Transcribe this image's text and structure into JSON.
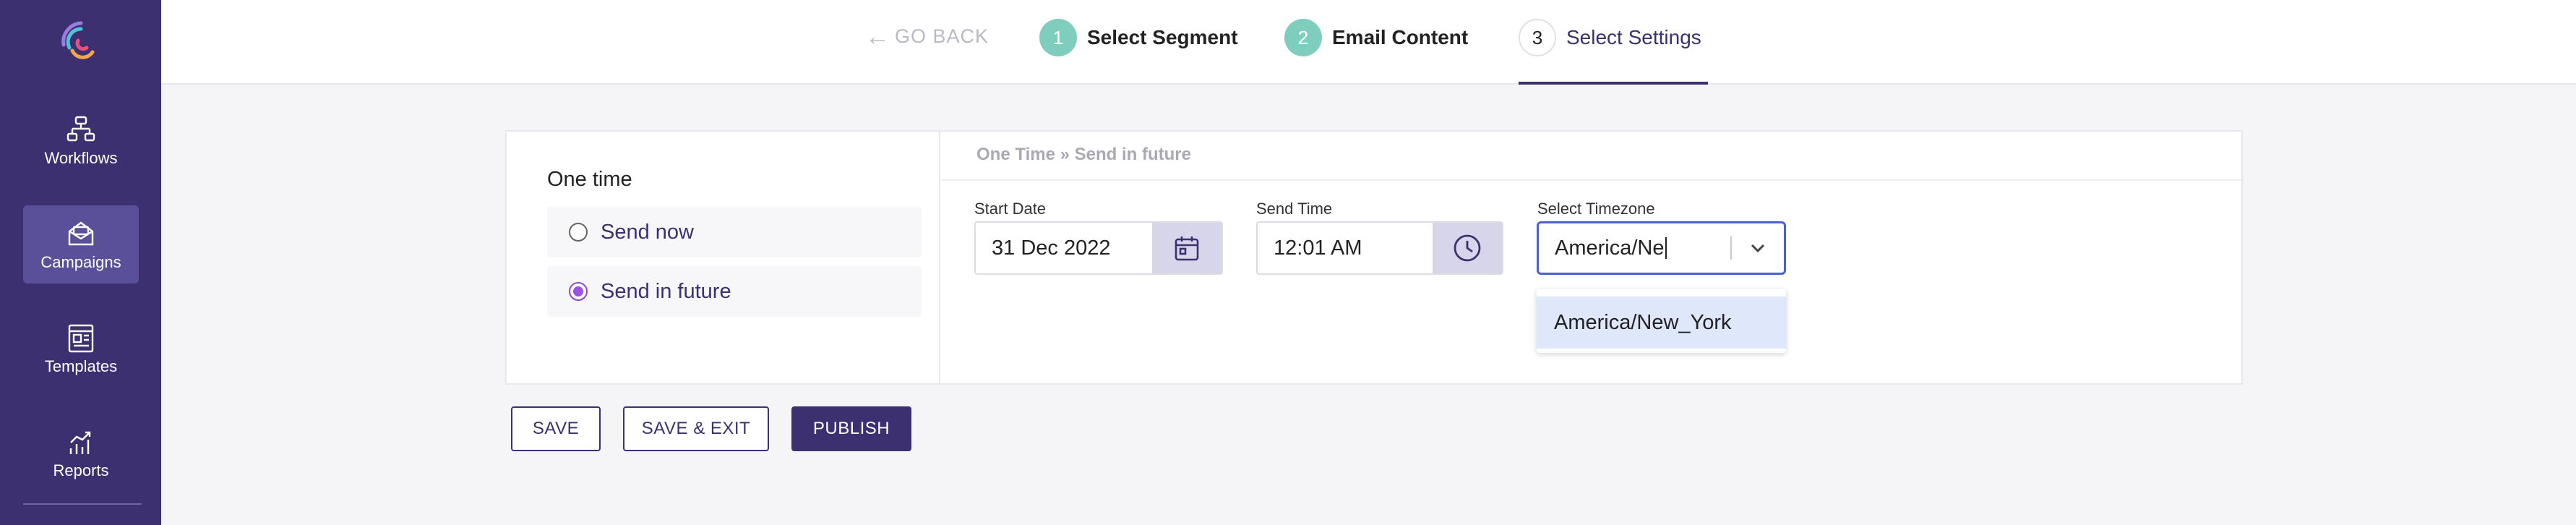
{
  "sidebar": {
    "items": [
      {
        "label": "Workflows",
        "icon": "workflow-icon"
      },
      {
        "label": "Campaigns",
        "icon": "envelope-icon",
        "active": true
      },
      {
        "label": "Templates",
        "icon": "template-icon"
      },
      {
        "label": "Reports",
        "icon": "chart-icon"
      }
    ]
  },
  "header": {
    "go_back": "GO BACK",
    "steps": [
      {
        "num": "1",
        "label": "Select Segment"
      },
      {
        "num": "2",
        "label": "Email Content"
      },
      {
        "num": "3",
        "label": "Select Settings"
      }
    ]
  },
  "schedule": {
    "section_title": "One time",
    "options": [
      "Send now",
      "Send in future"
    ],
    "selected": "Send in future",
    "breadcrumb": "One Time » Send in future",
    "start_date": {
      "label": "Start Date",
      "value": "31 Dec 2022"
    },
    "send_time": {
      "label": "Send Time",
      "value": "12:01 AM"
    },
    "timezone": {
      "label": "Select Timezone",
      "value": "America/Ne",
      "suggestion": "America/New_York"
    }
  },
  "actions": {
    "save": "SAVE",
    "save_exit": "SAVE & EXIT",
    "publish": "PUBLISH"
  },
  "colors": {
    "sidebar_bg": "#3d3070",
    "accent": "#3d3070",
    "step_done": "#7ecdbd",
    "radio_selected": "#9b52e0",
    "focus_border": "#4a62c9"
  }
}
